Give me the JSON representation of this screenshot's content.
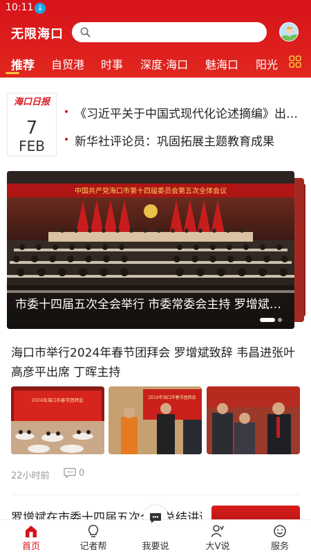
{
  "status_bar": {
    "time": "10:11",
    "download_icon": "download-icon"
  },
  "header": {
    "app_title": "无限海口",
    "search": {
      "placeholder": "",
      "icon": "search-icon"
    },
    "avatar_icon": "avatar-icon",
    "tabs": [
      {
        "label": "推荐",
        "active": true
      },
      {
        "label": "自贸港"
      },
      {
        "label": "时事"
      },
      {
        "label": "深度·海口"
      },
      {
        "label": "魅海口"
      },
      {
        "label": "阳光"
      }
    ],
    "more_icon": "channel-grid-icon"
  },
  "paper": {
    "logo_text": "海口日报",
    "day": "7",
    "month": "FEB",
    "headlines": [
      "《习近平关于中国式现代化论述摘编》出版发行",
      "新华社评论员：巩固拓展主题教育成果"
    ]
  },
  "banner": {
    "slogan": "中国共产党海口市第十四届委员会第五次全体会议",
    "caption": "市委十四届五次全会举行 市委常委会主持 罗增斌讲话",
    "dot_count": 2
  },
  "article": {
    "title": "海口市举行2024年春节团拜会 罗增斌致辞 韦昌进张叶高彦平出席 丁晖主持",
    "thumb1_sign": "2024年海口市春节团拜会",
    "thumb2_sign": "2024年海口市春节团拜会",
    "time": "22小时前",
    "comment_count": "0",
    "comment_icon": "comment-icon"
  },
  "next_article": {
    "title": "罗增斌在市委十四届五次全会总结讲话"
  },
  "bottom_nav": [
    {
      "label": "首页",
      "icon": "home-icon",
      "active": true
    },
    {
      "label": "记者帮",
      "icon": "lightbulb-icon"
    },
    {
      "label": "我要说",
      "icon": "microphone-chat-icon"
    },
    {
      "label": "大V说",
      "icon": "user-v-icon"
    },
    {
      "label": "服务",
      "icon": "smile-service-icon"
    }
  ],
  "colors": {
    "brand_red": "#d6131a",
    "tab_indicator": "#f7c63a",
    "meta_gray": "#9a9a9a"
  }
}
